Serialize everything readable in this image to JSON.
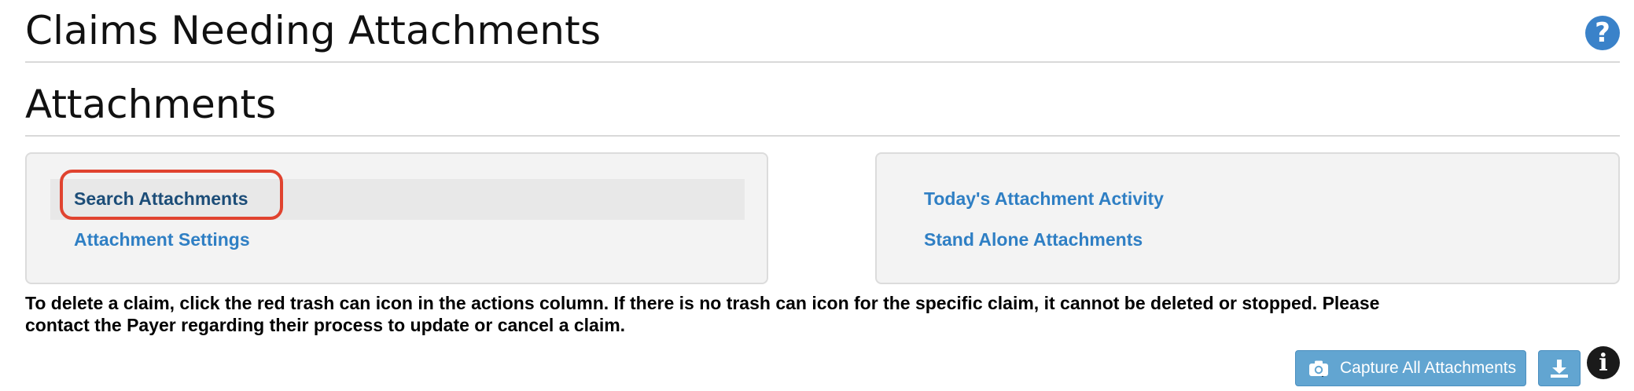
{
  "header": {
    "title": "Claims Needing Attachments",
    "help_icon": "question-circle-icon",
    "help_glyph": "?"
  },
  "section": {
    "title": "Attachments"
  },
  "left_panel": {
    "links": [
      {
        "label": "Search Attachments",
        "state": "focused"
      },
      {
        "label": "Attachment Settings"
      }
    ]
  },
  "right_panel": {
    "links": [
      {
        "label": "Today's Attachment Activity"
      },
      {
        "label": "Stand Alone Attachments"
      }
    ]
  },
  "notice": {
    "line1": "To delete a claim, click the red trash can icon in the actions column. If there is no trash can icon for the specific claim, it cannot be deleted or stopped. Please",
    "line2": "contact the Payer regarding their process to update or cancel a claim."
  },
  "toolbar": {
    "capture_label": "Capture All Attachments",
    "capture_icon": "camera-icon",
    "download_icon": "download-icon",
    "info_icon": "info-circle-icon",
    "info_glyph": "i"
  },
  "colors": {
    "link": "#2f7fc4",
    "link_active": "#1c4d78",
    "focus_ring": "#e0432f",
    "button": "#62a5d1",
    "help": "#3a82c9"
  }
}
